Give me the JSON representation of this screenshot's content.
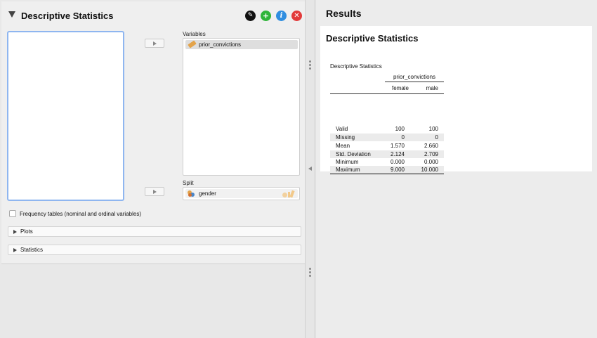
{
  "analysis": {
    "title": "Descriptive Statistics",
    "variables_label": "Variables",
    "variables": [
      "prior_convictions"
    ],
    "split_label": "Split",
    "split_variable": "gender",
    "frequency_tables_label": "Frequency tables (nominal and ordinal variables)",
    "sections": [
      "Plots",
      "Statistics"
    ],
    "header_icons": [
      "edit-icon",
      "add-icon",
      "info-icon",
      "close-icon"
    ],
    "header_icon_colors": [
      "#111111",
      "#2fb53a",
      "#2f8ee0",
      "#e23a3a"
    ]
  },
  "results": {
    "panel_title": "Results",
    "heading": "Descriptive Statistics",
    "table": {
      "caption": "Descriptive Statistics",
      "group_header": "prior_convictions",
      "columns": [
        "female",
        "male"
      ],
      "rows": [
        {
          "label": "Valid",
          "values": [
            "100",
            "100"
          ]
        },
        {
          "label": "Missing",
          "values": [
            "0",
            "0"
          ]
        },
        {
          "label": "Mean",
          "values": [
            "1.570",
            "2.660"
          ]
        },
        {
          "label": "Std. Deviation",
          "values": [
            "2.124",
            "2.709"
          ]
        },
        {
          "label": "Minimum",
          "values": [
            "0.000",
            "0.000"
          ]
        },
        {
          "label": "Maximum",
          "values": [
            "9.000",
            "10.000"
          ]
        }
      ]
    }
  }
}
